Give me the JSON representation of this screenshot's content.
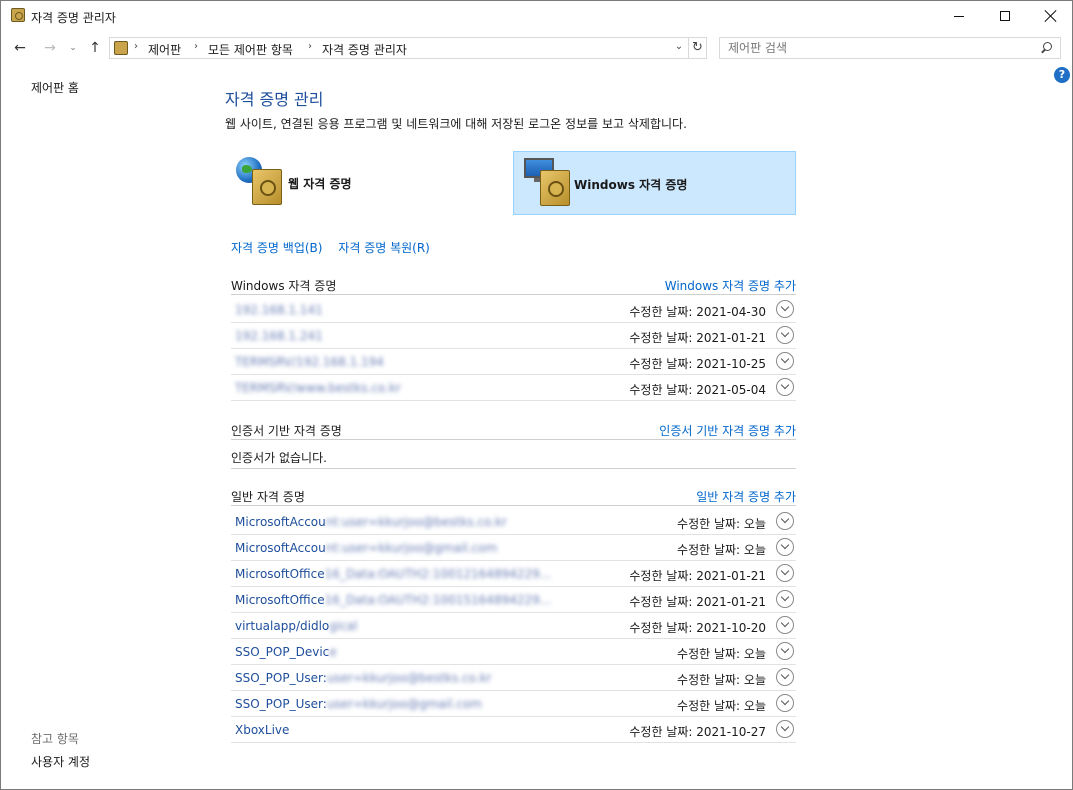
{
  "window": {
    "title": "자격 증명 관리자"
  },
  "nav": {
    "breadcrumbs": [
      "제어판",
      "모든 제어판 항목",
      "자격 증명 관리자"
    ],
    "search_placeholder": "제어판 검색"
  },
  "sidebar": {
    "home": "제어판 홈",
    "see_also": "참고 항목",
    "user_accounts": "사용자 계정"
  },
  "main": {
    "title": "자격 증명 관리",
    "description": "웹 사이트, 연결된 응용 프로그램 및 네트워크에 대해 저장된 로그온 정보를 보고 삭제합니다.",
    "tiles": {
      "web": "웹 자격 증명",
      "windows": "Windows 자격 증명"
    },
    "links": {
      "backup": "자격 증명 백업(B)",
      "restore": "자격 증명 복원(R)"
    }
  },
  "sections": {
    "windows": {
      "header": "Windows 자격 증명",
      "add": "Windows 자격 증명 추가",
      "items": [
        {
          "name": "192.168.1.141",
          "modified": "수정한 날짜:  2021-04-30"
        },
        {
          "name": "192.168.1.241",
          "modified": "수정한 날짜:  2021-01-21"
        },
        {
          "name": "TERMSRV/192.168.1.194",
          "modified": "수정한 날짜:  2021-10-25"
        },
        {
          "name": "TERMSRV/www.bestks.co.kr",
          "modified": "수정한 날짜:  2021-05-04"
        }
      ]
    },
    "certificate": {
      "header": "인증서 기반 자격 증명",
      "add": "인증서 기반 자격 증명 추가",
      "empty": "인증서가 없습니다."
    },
    "generic": {
      "header": "일반 자격 증명",
      "add": "일반 자격 증명 추가",
      "items": [
        {
          "prefix": "MicrosoftAccou",
          "rest": "nt:user=kkurjoo@bestks.co.kr",
          "modified": "수정한 날짜:  오늘"
        },
        {
          "prefix": "MicrosoftAccou",
          "rest": "nt:user=kkurjoo@gmail.com",
          "modified": "수정한 날짜:  오늘"
        },
        {
          "prefix": "MicrosoftOffice",
          "rest": "16_Data:OAUTH2:10012164894229...",
          "modified": "수정한 날짜:  2021-01-21"
        },
        {
          "prefix": "MicrosoftOffice",
          "rest": "16_Data:OAUTH2:10015164894229...",
          "modified": "수정한 날짜:  2021-01-21"
        },
        {
          "prefix": "virtualapp/didlo",
          "rest": "gical",
          "modified": "수정한 날짜:  2021-10-20"
        },
        {
          "prefix": "SSO_POP_Devic",
          "rest": "e",
          "modified": "수정한 날짜:  오늘"
        },
        {
          "prefix": "SSO_POP_User:",
          "rest": "user=kkurjoo@bestks.co.kr",
          "modified": "수정한 날짜:  오늘"
        },
        {
          "prefix": "SSO_POP_User:",
          "rest": "user=kkurjoo@gmail.com",
          "modified": "수정한 날짜:  오늘"
        },
        {
          "prefix": "XboxLive",
          "rest": "",
          "modified": "수정한 날짜:  2021-10-27"
        }
      ]
    }
  }
}
